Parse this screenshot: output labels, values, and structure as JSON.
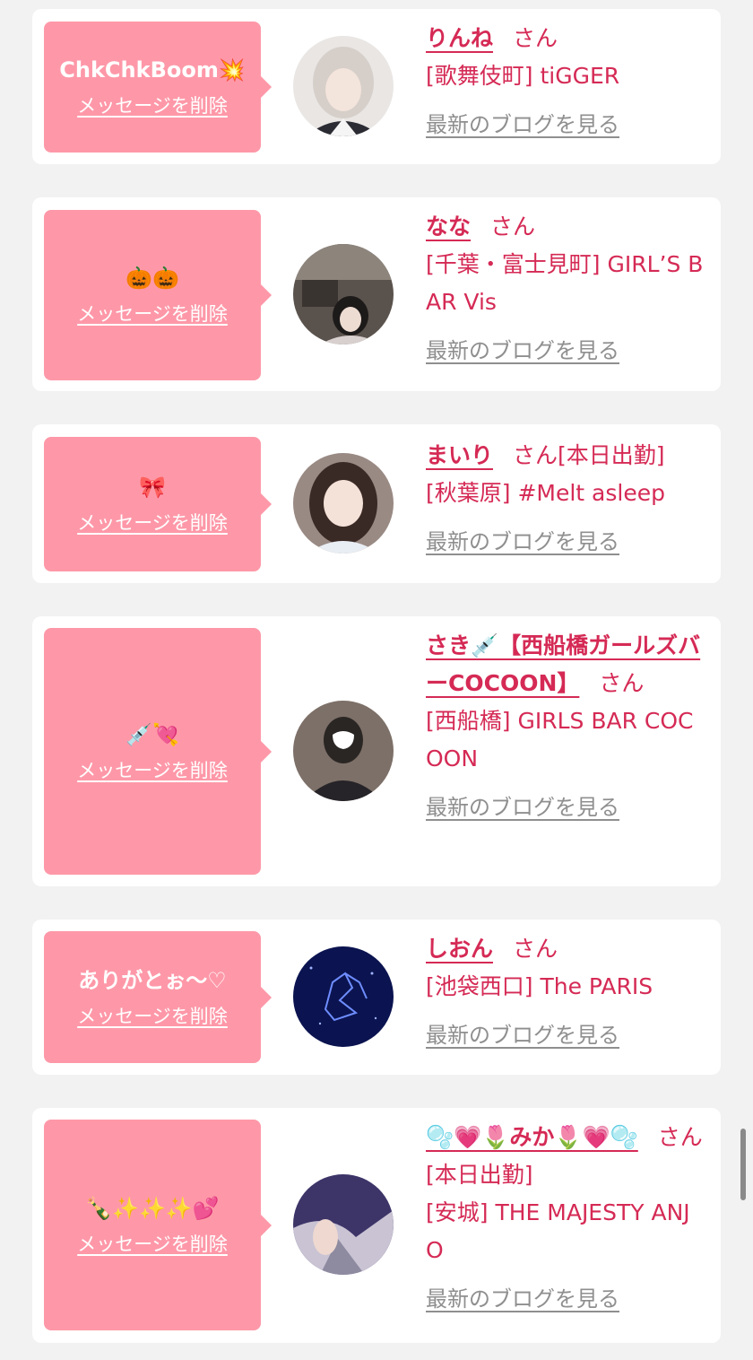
{
  "delete_label": "メッセージを削除",
  "san_label": "さん",
  "blog_label": "最新のブログを見る",
  "cards": [
    {
      "message": "ChkChkBoom💥",
      "name": "りんね",
      "status": "",
      "shop": "[歌舞伎町] tiGGER"
    },
    {
      "message": "🎃🎃",
      "name": "なな",
      "status": "",
      "shop": "[千葉・富士見町] GIRL’S BAR Vis"
    },
    {
      "message": "🎀",
      "name": "まいり",
      "status": "[本日出勤]",
      "shop": "[秋葉原] #Melt asleep"
    },
    {
      "message": "💉💘",
      "name": "さき💉【西船橋ガールズバーCOCOON】",
      "status": "",
      "shop": "[西船橋] GIRLS BAR COCOON"
    },
    {
      "message": "ありがとぉ〜♡",
      "name": "しおん",
      "status": "",
      "shop": "[池袋西口] The PARIS"
    },
    {
      "message": "🍾✨✨✨💕",
      "name": "🫧💗🌷みか🌷💗🫧",
      "status": "[本日出勤]",
      "shop": "[安城] THE MAJESTY ANJO"
    }
  ]
}
